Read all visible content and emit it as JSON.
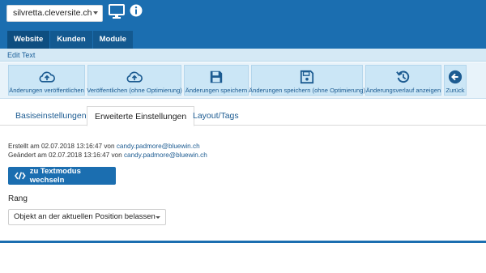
{
  "header": {
    "site_select_value": "silvretta.cleversite.ch",
    "icons": [
      "monitor-icon",
      "info-icon"
    ]
  },
  "nav": {
    "tabs": [
      {
        "label": "Website"
      },
      {
        "label": "Kunden"
      },
      {
        "label": "Module"
      }
    ]
  },
  "subbar": {
    "title": "Edit Text"
  },
  "toolbar": {
    "buttons": [
      {
        "label": "Änderungen veröffentlichen",
        "icon": "cloud-upload-icon"
      },
      {
        "label": "Veröffentlichen (ohne Optimierung)",
        "icon": "cloud-upload-icon"
      },
      {
        "label": "Änderungen speichern",
        "icon": "floppy-disk-icon"
      },
      {
        "label": "Änderungen speichern (ohne Optimierung)",
        "icon": "floppy-disk-icon"
      },
      {
        "label": "Änderungsverlauf anzeigen",
        "icon": "history-icon"
      },
      {
        "label": "Zurück",
        "icon": "arrow-left-circle-icon"
      }
    ]
  },
  "content_tabs": [
    {
      "label": "Basiseinstellungen"
    },
    {
      "label": "Erweiterte Einstellungen"
    },
    {
      "label": "Layout/Tags"
    }
  ],
  "meta": {
    "created_prefix": "Erstellt am 02.07.2018 13:16:47 von",
    "created_by": "candy.padmore@bluewin.ch",
    "changed_prefix": "Geändert am 02.07.2018 13:16:47 von",
    "changed_by": "candy.padmore@bluewin.ch"
  },
  "textmode_button": {
    "label": "zu Textmodus wechseln",
    "icon": "code-icon"
  },
  "rang": {
    "label": "Rang",
    "selected": "Objekt an der aktuellen Position belassen"
  },
  "colors": {
    "primary": "#1b6eb0",
    "nav_tab": "#135990",
    "toolbar_bg": "#e8f3fa",
    "toolbar_button": "#cbe6f6",
    "link": "#1c5b91"
  }
}
